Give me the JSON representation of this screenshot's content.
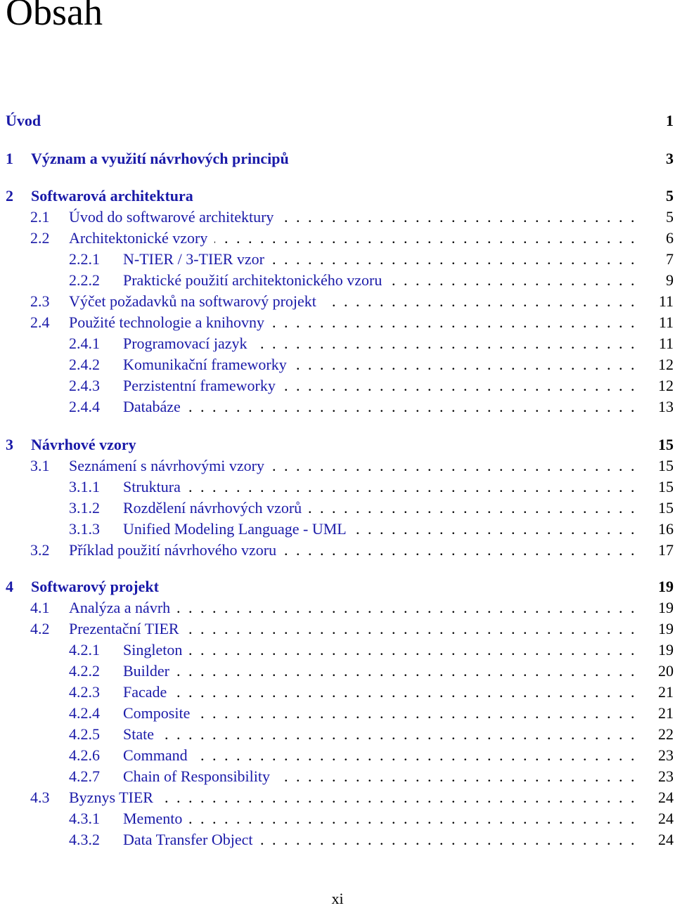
{
  "page": {
    "title": "Obsah",
    "footer_page_number": "xi"
  },
  "colors": {
    "link": "#1a1aa8",
    "page_number": "#000000"
  },
  "toc": [
    {
      "level": 0,
      "number": "",
      "title": "Úvod",
      "page": "1"
    },
    {
      "level": 0,
      "number": "1",
      "title": "Význam a využití návrhových principů",
      "page": "3"
    },
    {
      "level": 0,
      "number": "2",
      "title": "Softwarová architektura",
      "page": "5"
    },
    {
      "level": 1,
      "number": "2.1",
      "title": "Úvod do softwarové architektury",
      "page": "5"
    },
    {
      "level": 1,
      "number": "2.2",
      "title": "Architektonické vzory",
      "page": "6"
    },
    {
      "level": 2,
      "number": "2.2.1",
      "title": "N-TIER / 3-TIER vzor",
      "page": "7"
    },
    {
      "level": 2,
      "number": "2.2.2",
      "title": "Praktické použití architektonického vzoru",
      "page": "9"
    },
    {
      "level": 1,
      "number": "2.3",
      "title": "Výčet požadavků na softwarový projekt",
      "page": "11"
    },
    {
      "level": 1,
      "number": "2.4",
      "title": "Použité technologie a knihovny",
      "page": "11"
    },
    {
      "level": 2,
      "number": "2.4.1",
      "title": "Programovací jazyk",
      "page": "11"
    },
    {
      "level": 2,
      "number": "2.4.2",
      "title": "Komunikační frameworky",
      "page": "12"
    },
    {
      "level": 2,
      "number": "2.4.3",
      "title": "Perzistentní frameworky",
      "page": "12"
    },
    {
      "level": 2,
      "number": "2.4.4",
      "title": "Databáze",
      "page": "13"
    },
    {
      "level": 0,
      "number": "3",
      "title": "Návrhové vzory",
      "page": "15"
    },
    {
      "level": 1,
      "number": "3.1",
      "title": "Seznámení s návrhovými vzory",
      "page": "15"
    },
    {
      "level": 2,
      "number": "3.1.1",
      "title": "Struktura",
      "page": "15"
    },
    {
      "level": 2,
      "number": "3.1.2",
      "title": "Rozdělení návrhových vzorů",
      "page": "15"
    },
    {
      "level": 2,
      "number": "3.1.3",
      "title": "Unified Modeling Language - UML",
      "page": "16"
    },
    {
      "level": 1,
      "number": "3.2",
      "title": "Příklad použití návrhového vzoru",
      "page": "17"
    },
    {
      "level": 0,
      "number": "4",
      "title": "Softwarový projekt",
      "page": "19"
    },
    {
      "level": 1,
      "number": "4.1",
      "title": "Analýza a návrh",
      "page": "19"
    },
    {
      "level": 1,
      "number": "4.2",
      "title": "Prezentační TIER",
      "page": "19"
    },
    {
      "level": 2,
      "number": "4.2.1",
      "title": "Singleton",
      "page": "19"
    },
    {
      "level": 2,
      "number": "4.2.2",
      "title": "Builder",
      "page": "20"
    },
    {
      "level": 2,
      "number": "4.2.3",
      "title": "Facade",
      "page": "21"
    },
    {
      "level": 2,
      "number": "4.2.4",
      "title": "Composite",
      "page": "21"
    },
    {
      "level": 2,
      "number": "4.2.5",
      "title": "State",
      "page": "22"
    },
    {
      "level": 2,
      "number": "4.2.6",
      "title": "Command",
      "page": "23"
    },
    {
      "level": 2,
      "number": "4.2.7",
      "title": "Chain of Responsibility",
      "page": "23"
    },
    {
      "level": 1,
      "number": "4.3",
      "title": "Byznys TIER",
      "page": "24"
    },
    {
      "level": 2,
      "number": "4.3.1",
      "title": "Memento",
      "page": "24"
    },
    {
      "level": 2,
      "number": "4.3.2",
      "title": "Data Transfer Object",
      "page": "24"
    }
  ]
}
